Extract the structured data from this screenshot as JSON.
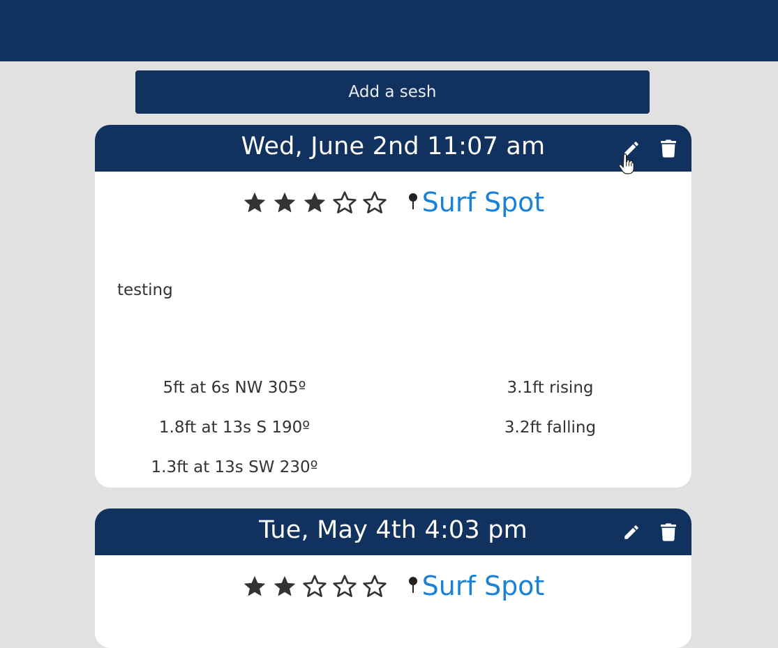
{
  "header": {},
  "actions": {
    "add_label": "Add a sesh"
  },
  "colors": {
    "navy": "#11315e",
    "background": "#e1e1e1",
    "link": "#1a82d6",
    "text": "#333333"
  },
  "sessions": [
    {
      "title": "Wed, June 2nd 11:07 am",
      "rating": 3,
      "rating_max": 5,
      "spot": "Surf Spot",
      "notes": "testing",
      "swells": [
        "5ft at 6s NW 305º",
        "1.8ft at 13s S 190º",
        "1.3ft at 13s SW 230º"
      ],
      "tides": [
        "3.1ft rising",
        "3.2ft falling"
      ],
      "icons": [
        "pencil-icon",
        "trash-icon",
        "map-pin-icon",
        "hand-pointer-icon"
      ]
    },
    {
      "title": "Tue, May 4th 4:03 pm",
      "rating": 2,
      "rating_max": 5,
      "spot": "Surf Spot",
      "icons": [
        "pencil-icon",
        "trash-icon",
        "map-pin-icon"
      ]
    }
  ]
}
